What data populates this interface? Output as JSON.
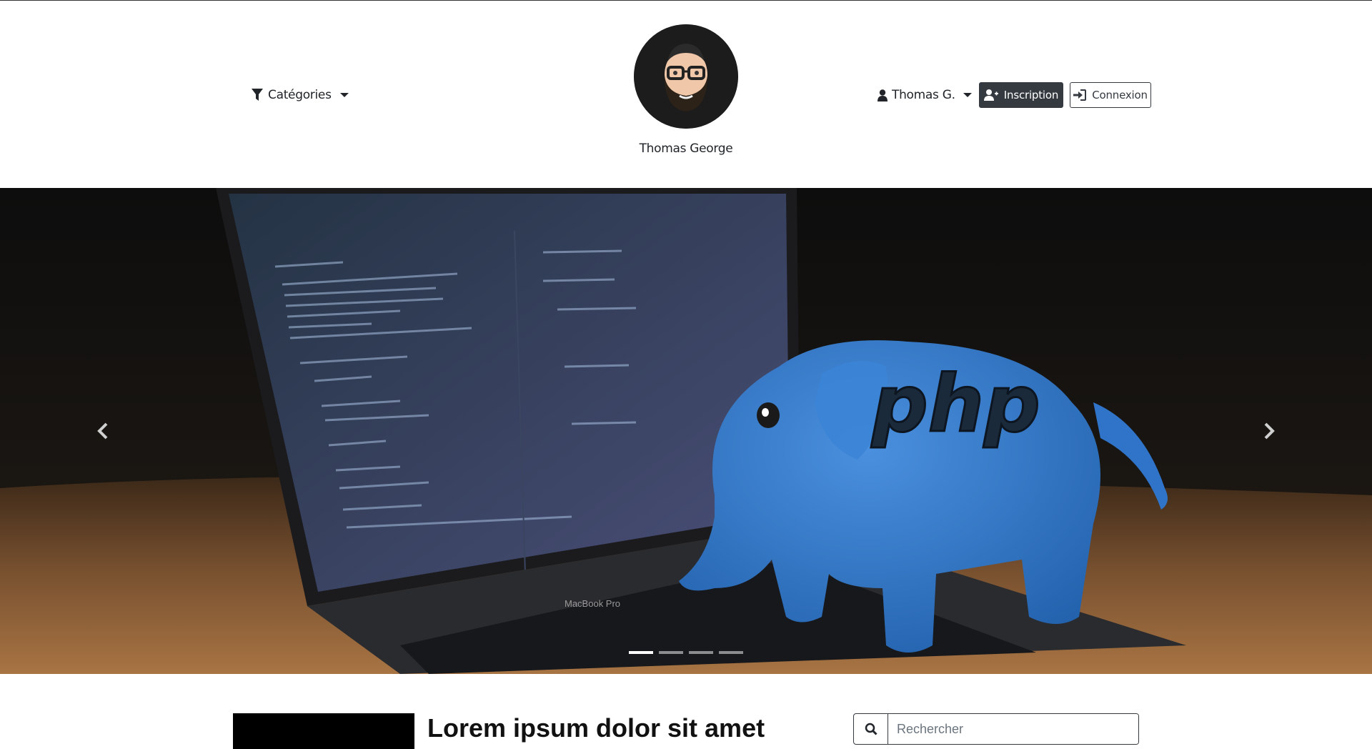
{
  "header": {
    "categories_label": "Catégories",
    "author_name": "Thomas George",
    "user_menu_label": "Thomas G.",
    "register_label": "Inscription",
    "login_label": "Connexion"
  },
  "carousel": {
    "slide_count": 4,
    "active_slide": 1,
    "laptop_label": "MacBook Pro",
    "mascot_text": "php"
  },
  "post": {
    "title": "Lorem ipsum dolor sit amet"
  },
  "search": {
    "placeholder": "Rechercher"
  },
  "colors": {
    "dark_button": "#343a40",
    "mascot_blue": "#2f74c8"
  }
}
